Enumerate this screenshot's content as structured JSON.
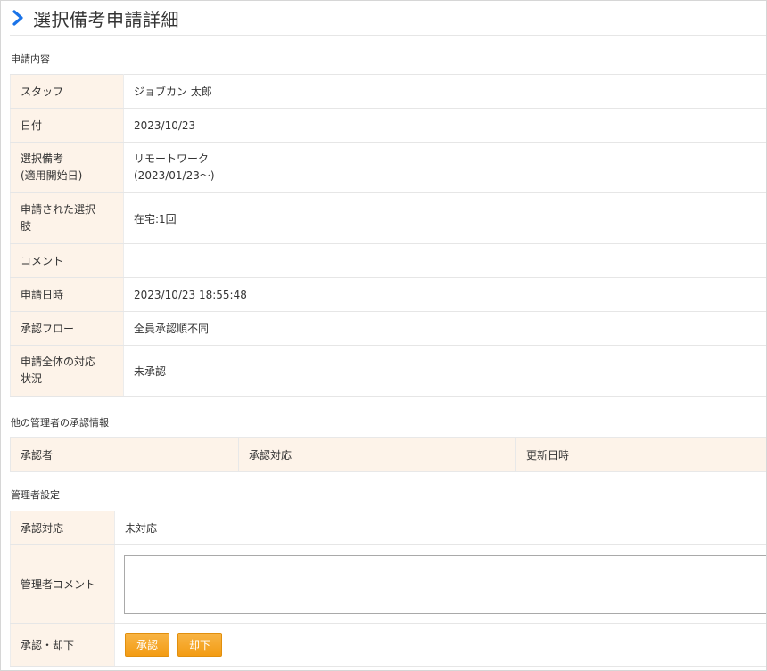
{
  "page": {
    "title": "選択備考申請詳細"
  },
  "sections": {
    "request": "申請内容",
    "approvals": "他の管理者の承認情報",
    "admin": "管理者設定"
  },
  "request_rows": [
    {
      "label": "スタッフ",
      "value": "ジョブカン 太郎"
    },
    {
      "label": "日付",
      "value": "2023/10/23"
    },
    {
      "label_line1": "選択備考",
      "label_line2": "(適用開始日)",
      "value_line1": "リモートワーク",
      "value_line2": "(2023/01/23〜)"
    },
    {
      "label_line1": "申請された選択",
      "label_line2": "肢",
      "value": "在宅:1回"
    },
    {
      "label": "コメント",
      "value": ""
    },
    {
      "label": "申請日時",
      "value": "2023/10/23 18:55:48"
    },
    {
      "label": "承認フロー",
      "value": "全員承認順不同"
    },
    {
      "label_line1": "申請全体の対応",
      "label_line2": "状況",
      "value": "未承認"
    }
  ],
  "approval_table": {
    "headers": [
      "承認者",
      "承認対応",
      "更新日時"
    ]
  },
  "admin_rows": {
    "status_label": "承認対応",
    "status_value": "未対応",
    "comment_label": "管理者コメント",
    "comment_value": "",
    "actions_label": "承認・却下",
    "approve_button": "承認",
    "reject_button": "却下"
  },
  "colors": {
    "header_bg": "#fdf3e9",
    "button": "#f39c13",
    "chevron": "#1a73e8"
  },
  "icons": {
    "title_icon": "chevron-right-icon"
  }
}
